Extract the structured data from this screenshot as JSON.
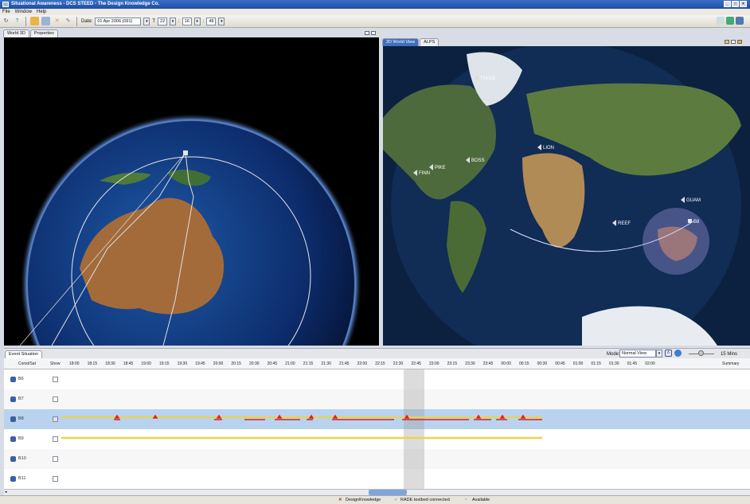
{
  "window": {
    "title": "Situational Awareness - DCS STEED - The Design Knowledge Co."
  },
  "menu": [
    {
      "label": "File"
    },
    {
      "label": "Window"
    },
    {
      "label": "Help"
    }
  ],
  "toolbar": {
    "date_label": "Date:",
    "date_value": "01 Apr 2006 (091)",
    "separator_t": "T",
    "hour": "22",
    "minute": "16",
    "second": "48",
    "colon": ":"
  },
  "left_tabs": [
    {
      "label": "World 3D"
    },
    {
      "label": "Properties"
    }
  ],
  "right_tabs": [
    {
      "label": "2D World View"
    },
    {
      "label": "ALPS"
    }
  ],
  "map_labels": [
    "THULE",
    "LION",
    "PIKE",
    "BOSS",
    "GUAM",
    "REEF",
    "B8",
    "FINN"
  ],
  "event": {
    "tab": "Event Situation",
    "mode_label": "Mode:",
    "mode_value": "Normal View",
    "interval": "15 Mins",
    "col_const": "Const/Sat",
    "col_show": "Show",
    "col_summary": "Summary",
    "times": [
      "18:00",
      "18:15",
      "18:30",
      "18:45",
      "19:00",
      "19:15",
      "19:30",
      "19:45",
      "20:00",
      "20:15",
      "20:30",
      "20:45",
      "21:00",
      "21:15",
      "21:30",
      "21:45",
      "22:00",
      "22:15",
      "22:30",
      "22:45",
      "23:00",
      "23:15",
      "23:30",
      "23:45",
      "00:00",
      "00:15",
      "00:30",
      "00:45",
      "01:00",
      "01:15",
      "01:30",
      "01:45",
      "02:00"
    ],
    "rows": [
      {
        "name": "B6",
        "checked": false
      },
      {
        "name": "B7",
        "checked": false
      },
      {
        "name": "B8",
        "checked": true
      },
      {
        "name": "B9",
        "checked": false
      },
      {
        "name": "B10",
        "checked": false
      },
      {
        "name": "B11",
        "checked": false
      }
    ]
  },
  "status": {
    "brand": "DesignKnowledge",
    "connection": "RADE testbed connected",
    "availability": "Available"
  },
  "colors": {
    "selected_row": "#b9d3ee",
    "pass_line": "#e9d44a",
    "event_marker": "#e02020",
    "cursor": "#9a9a9a"
  }
}
